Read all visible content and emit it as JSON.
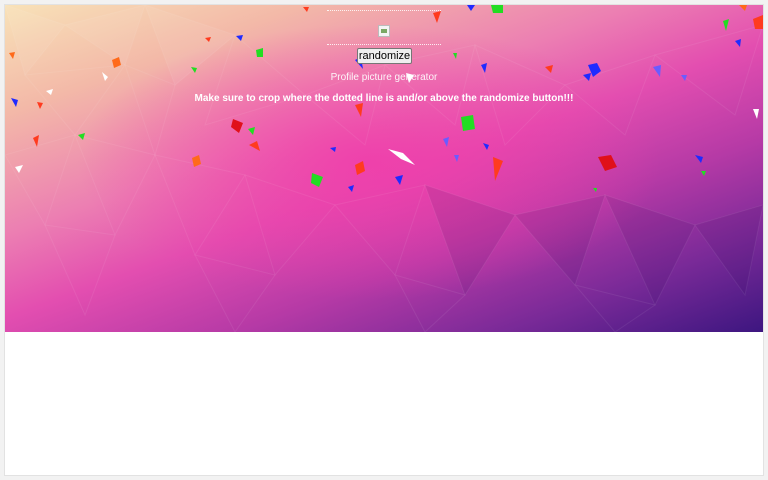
{
  "app": {
    "randomize_label": "randomize",
    "subtitle": "Profile picture generator",
    "instruction": "Make sure to crop where the dotted line is and/or above the randomize button!!!"
  },
  "colors": {
    "gradient_top_left": "#f8e2b8",
    "gradient_center": "#e34eb0",
    "gradient_bottom_right": "#3d1680",
    "confetti": [
      "#ff3b1f",
      "#1f2bff",
      "#22dd22",
      "#ff6a1a",
      "#6a5cff"
    ]
  },
  "icons": {
    "avatar": "broken-image-icon"
  }
}
